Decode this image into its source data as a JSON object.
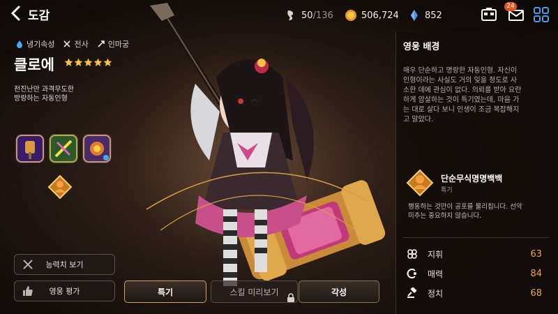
{
  "header": {
    "title": "도감",
    "stamina": {
      "current": "50",
      "max": "/136"
    },
    "gold": "506,724",
    "gems": "852",
    "mail_badge": "24"
  },
  "hero": {
    "attributes": [
      {
        "icon": "water-drop-icon",
        "label": "냉기속성"
      },
      {
        "icon": "crossed-swords-icon",
        "label": "전사"
      },
      {
        "icon": "arrow-icon",
        "label": "인마궁"
      }
    ],
    "name": "클로에",
    "stars": 5,
    "description": [
      "천진난만 과격무도한",
      "방랑하는 자동인형"
    ]
  },
  "left_buttons": {
    "stats": "능력치 보기",
    "review": "영웅 평가"
  },
  "tabs": {
    "trait": "특기",
    "skill_preview": "스킬 미리보기",
    "awaken": "각성"
  },
  "panel": {
    "title": "영웅 배경",
    "story": [
      "매우 단순하고 명랑한 자동인형. 자신이",
      "인형이라는 사실도 거의 잊을 정도로 사",
      "소한 데에 관심이 없다. 의뢰를 받아 요란",
      "하게 암살하는 것이 특기였는데, 마음 가",
      "는 대로 살다 보니 인생이 조금 복잡해지",
      "고 말았다."
    ],
    "trait": {
      "name": "단순무식명명백백",
      "type": "특기",
      "desc": [
        "행동하는 것만이 공포를 물리칩니다. 선악",
        "미추는 중요하지 않습니다."
      ]
    },
    "stats": [
      {
        "icon": "cloverleaf-icon",
        "label": "지휘",
        "value": "63"
      },
      {
        "icon": "charm-icon",
        "label": "매력",
        "value": "84"
      },
      {
        "icon": "gavel-icon",
        "label": "정치",
        "value": "68"
      }
    ]
  },
  "colors": {
    "accent": "#f0a640",
    "gold": "#f5c542",
    "active_border": "#c9a36a"
  }
}
